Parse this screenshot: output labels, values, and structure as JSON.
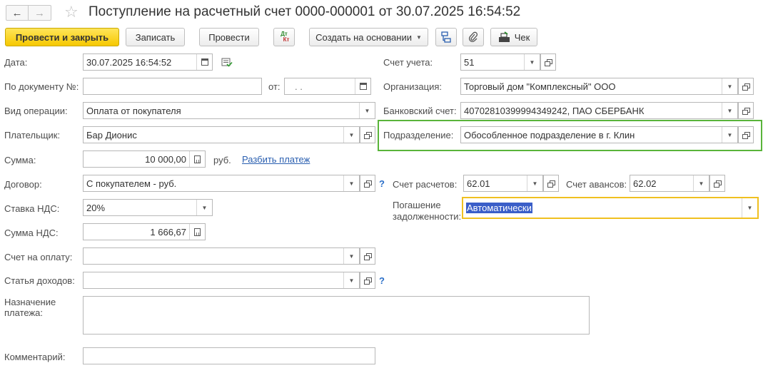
{
  "header": {
    "title": "Поступление на расчетный счет 0000-000001 от 30.07.2025 16:54:52",
    "back_glyph": "🡐",
    "forward_glyph": "→"
  },
  "toolbar": {
    "post_close": "Провести и закрыть",
    "save": "Записать",
    "post": "Провести",
    "dt_kt_top": "Дт",
    "dt_kt_bottom": "Кт",
    "create_based": "Создать на основании",
    "receipt": "Чек"
  },
  "form": {
    "date": {
      "label": "Дата:",
      "value": "30.07.2025 16:54:52"
    },
    "doc_num": {
      "label": "По документу №:",
      "value": "",
      "from_label": "от:",
      "from_value": " .  ."
    },
    "operation": {
      "label": "Вид операции:",
      "value": "Оплата от покупателя"
    },
    "payer": {
      "label": "Плательщик:",
      "value": "Бар Дионис"
    },
    "amount": {
      "label": "Сумма:",
      "value": "10 000,00",
      "currency": "руб.",
      "split_link": "Разбить платеж"
    },
    "contract": {
      "label": "Договор:",
      "value": "С покупателем - руб."
    },
    "vat_rate": {
      "label": "Ставка НДС:",
      "value": "20%"
    },
    "vat_amount": {
      "label": "Сумма НДС:",
      "value": "1 666,67"
    },
    "invoice": {
      "label": "Счет на оплату:",
      "value": ""
    },
    "income_item": {
      "label": "Статья доходов:",
      "value": ""
    },
    "purpose": {
      "label": "Назначение платежа:",
      "value": ""
    },
    "comment": {
      "label": "Комментарий:",
      "value": ""
    },
    "account": {
      "label": "Счет учета:",
      "value": "51"
    },
    "organization": {
      "label": "Организация:",
      "value": "Торговый дом \"Комплексный\" ООО"
    },
    "bank_account": {
      "label": "Банковский счет:",
      "value": "40702810399994349242, ПАО СБЕРБАНК"
    },
    "division": {
      "label": "Подразделение:",
      "value": "Обособленное подразделение в г. Клин"
    },
    "settlement_account": {
      "label": "Счет расчетов:",
      "value": "62.01"
    },
    "advance_account": {
      "label": "Счет авансов:",
      "value": "62.02"
    },
    "debt_repayment": {
      "label": "Погашение задолженности:",
      "label_line1": "Погашение",
      "label_line2": "задолженности:",
      "value": "Автоматически"
    },
    "help_mark": "?"
  },
  "colors": {
    "primary_button": "#f6c800",
    "highlight_green": "#59b43a",
    "highlight_yellow": "#f0c020",
    "selection": "#3a5ec8",
    "link": "#2a5fb0"
  }
}
